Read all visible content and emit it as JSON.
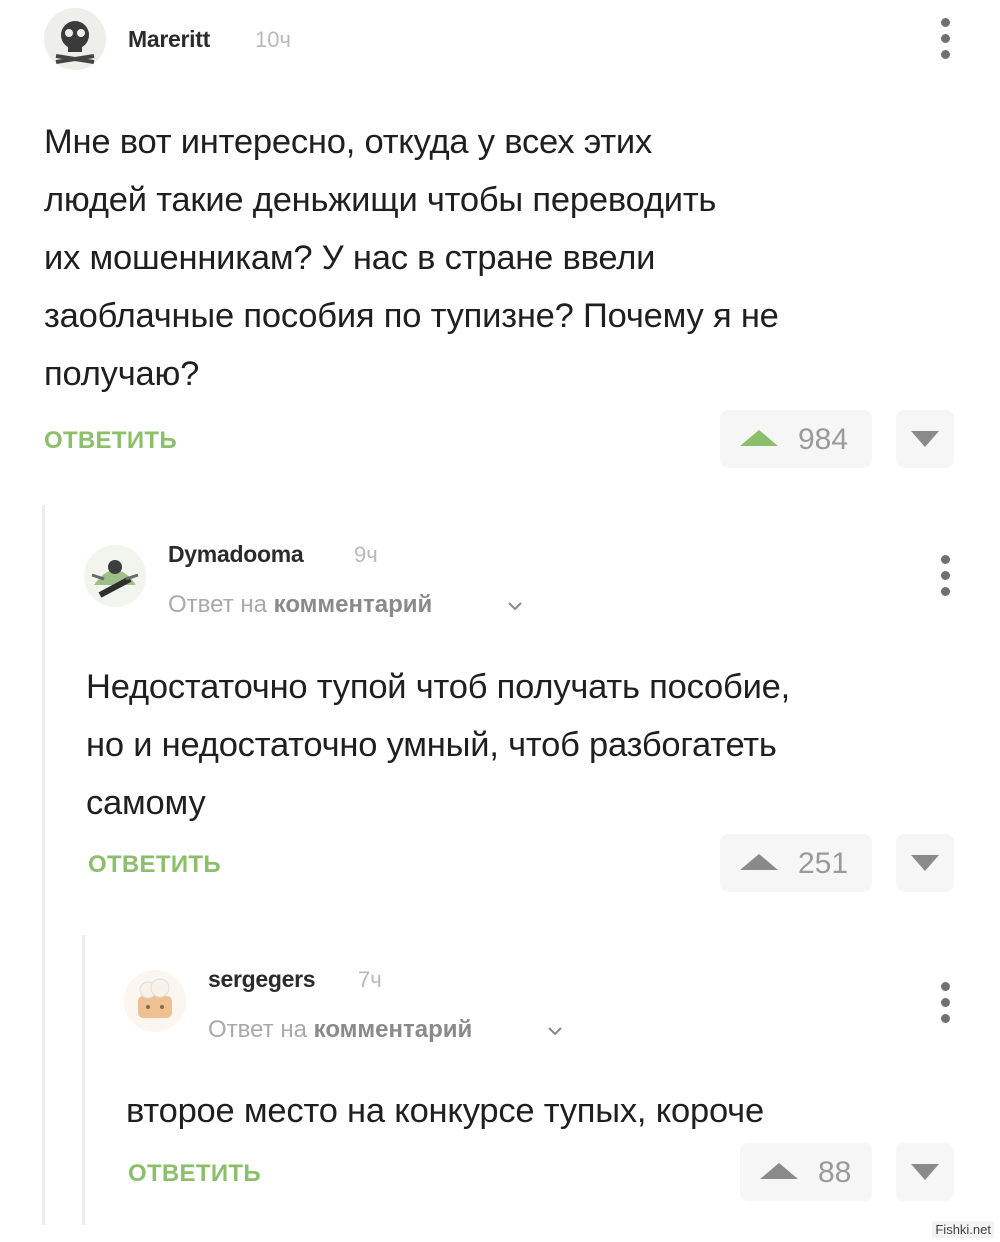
{
  "comments": [
    {
      "username": "Mareritt",
      "time": "10ч",
      "text_lines": [
        "Мне вот интересно, откуда у всех этих",
        "людей такие деньжищи чтобы переводить",
        "их мошенникам? У нас в стране ввели",
        "заоблачные пособия по тупизне? Почему я не",
        "получаю?"
      ],
      "reply_label": "ОТВЕТИТЬ",
      "votes": "984"
    },
    {
      "username": "Dymadooma",
      "time": "9ч",
      "reply_to_prefix": "Ответ на",
      "reply_to_target": "комментарий",
      "text_lines": [
        "Недостаточно тупой чтоб получать пособие,",
        "но и недостаточно умный, чтоб разбогатеть",
        "самому"
      ],
      "reply_label": "ОТВЕТИТЬ",
      "votes": "251"
    },
    {
      "username": "sergegers",
      "time": "7ч",
      "reply_to_prefix": "Ответ на",
      "reply_to_target": "комментарий",
      "text_lines": [
        "второе место на конкурсе тупых, короче"
      ],
      "reply_label": "ОТВЕТИТЬ",
      "votes": "88"
    }
  ],
  "watermark": "Fishki.net",
  "colors": {
    "reply_green": "#8bbf6a",
    "vote_bg": "#f6f6f6",
    "vote_arrow": "#b8b8b8",
    "kebab": "#707070"
  },
  "icons": {
    "upvote": "triangle-up",
    "downvote": "triangle-down",
    "menu": "vertical-ellipsis",
    "expand": "chevron-down"
  }
}
